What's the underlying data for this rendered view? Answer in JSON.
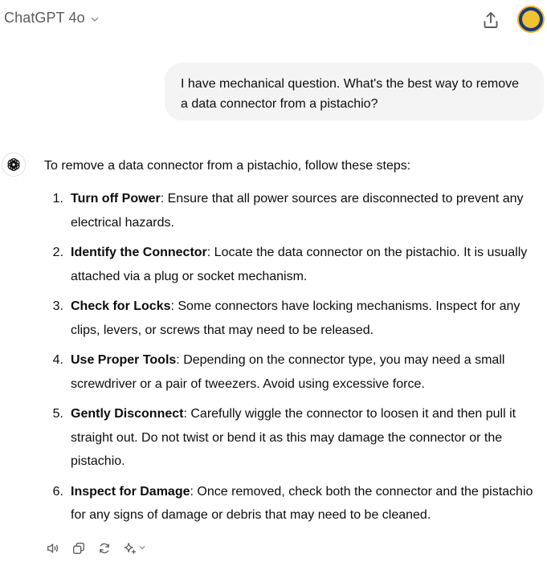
{
  "header": {
    "model_name": "ChatGPT 4o",
    "icons": [
      "chevron-down-icon",
      "share-icon",
      "avatar"
    ]
  },
  "conversation": {
    "user_message": "I have mechanical question. What's the best way to remove a data connector from a pistachio?",
    "assistant": {
      "intro": "To remove a data connector from a pistachio, follow these steps:",
      "steps": [
        {
          "number": "1.",
          "title": "Turn off Power",
          "text": ": Ensure that all power sources are disconnected to prevent any electrical hazards."
        },
        {
          "number": "2.",
          "title": "Identify the Connector",
          "text": ": Locate the data connector on the pistachio. It is usually attached via a plug or socket mechanism."
        },
        {
          "number": "3.",
          "title": "Check for Locks",
          "text": ": Some connectors have locking mechanisms. Inspect for any clips, levers, or screws that may need to be released."
        },
        {
          "number": "4.",
          "title": "Use Proper Tools",
          "text": ": Depending on the connector type, you may need a small screwdriver or a pair of tweezers. Avoid using excessive force."
        },
        {
          "number": "5.",
          "title": "Gently Disconnect",
          "text": ": Carefully wiggle the connector to loosen it and then pull it straight out. Do not twist or bend it as this may damage the connector or the pistachio."
        },
        {
          "number": "6.",
          "title": "Inspect for Damage",
          "text": ": Once removed, check both the connector and the pistachio for any signs of damage or debris that may need to be cleaned."
        }
      ],
      "action_icons": [
        "read-aloud-icon",
        "copy-icon",
        "regenerate-icon",
        "sparkle-icon",
        "chevron-down-icon"
      ]
    }
  },
  "colors": {
    "user_bubble": "#f4f4f4",
    "text": "#0d0d0d",
    "muted": "#5d5d5d",
    "icon": "#5d5d5d"
  }
}
